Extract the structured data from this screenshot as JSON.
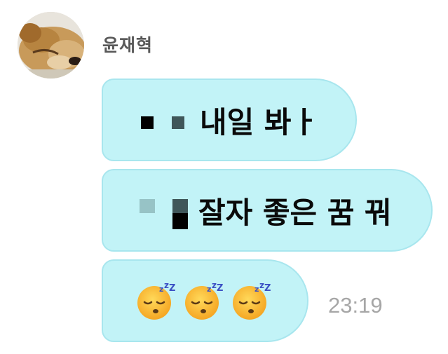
{
  "sender": {
    "name": "윤재혁"
  },
  "messages": [
    {
      "text": "내일 봐ㅏ"
    },
    {
      "text": "잘자 좋은 꿈 꿔"
    }
  ],
  "emojis": [
    {
      "icon": "sleeping-face-icon"
    },
    {
      "icon": "sleeping-face-icon"
    },
    {
      "icon": "sleeping-face-icon"
    }
  ],
  "timestamp": "23:19",
  "colors": {
    "bubble": "#c2f3f7",
    "bubble_border": "#a8e6ee",
    "sender": "#595959",
    "timestamp": "#a6a6a6"
  }
}
